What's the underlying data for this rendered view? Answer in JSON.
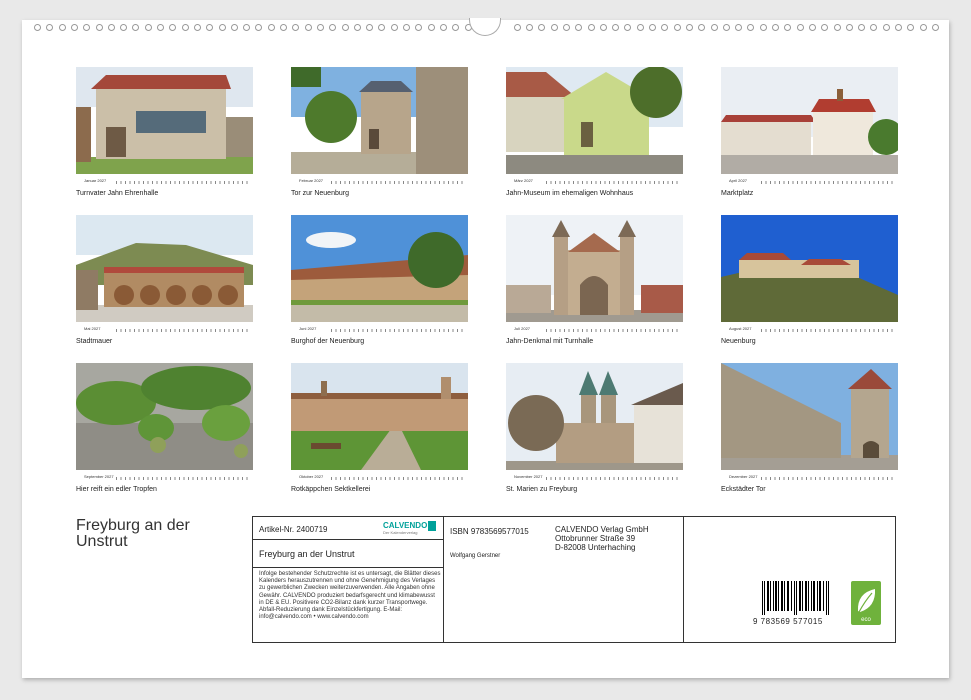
{
  "calendar_title": "Freyburg an der Unstrut",
  "months": [
    {
      "label": "Januar 2027",
      "caption": "Turnvater Jahn Ehrenhalle"
    },
    {
      "label": "Februar 2027",
      "caption": "Tor zur Neuenburg"
    },
    {
      "label": "März 2027",
      "caption": "Jahn-Museum im ehemaligen Wohnhaus"
    },
    {
      "label": "April 2027",
      "caption": "Marktplatz"
    },
    {
      "label": "Mai 2027",
      "caption": "Stadtmauer"
    },
    {
      "label": "Juni 2027",
      "caption": "Burghof der Neuenburg"
    },
    {
      "label": "Juli 2027",
      "caption": "Jahn-Denkmal mit Turnhalle"
    },
    {
      "label": "August 2027",
      "caption": "Neuenburg"
    },
    {
      "label": "September 2027",
      "caption": "Hier reift ein edler Tropfen"
    },
    {
      "label": "Oktober 2027",
      "caption": "Rotkäppchen Sektkellerei"
    },
    {
      "label": "November 2027",
      "caption": "St. Marien zu Freyburg"
    },
    {
      "label": "Dezember 2027",
      "caption": "Eckstädter Tor"
    }
  ],
  "info": {
    "article_no": "Artikel-Nr. 2400719",
    "brand": "CALVENDO",
    "brand_sub": "Der Kalenderverlag",
    "product_title": "Freyburg an der Unstrut",
    "isbn": "ISBN 9783569577015",
    "author": "Wolfgang Gerstner",
    "publisher_lines": [
      "CALVENDO Verlag GmbH",
      "Ottobrunner Straße 39",
      "D-82008 Unterhaching"
    ],
    "legal_text": "Infolge bestehender Schutzrechte ist es untersagt, die Blätter dieses Kalenders herauszutrennen und ohne Genehmigung des Verlages zu gewerblichen Zwecken weiterzuverwenden. Alle Angaben ohne Gewähr. CALVENDO produziert bedarfsgerecht und klimabewusst in DE & EU. Positivere CO2-Bilanz dank kurzer Transportwege. Abfall-Reduzierung dank Einzelstückfertigung. E-Mail: info@calvendo.com • www.calvendo.com",
    "barcode_digits": "9   783569   577015",
    "eco_label": "eco"
  },
  "colors": {
    "accent": "#00a19a",
    "eco": "#6fb23c"
  }
}
